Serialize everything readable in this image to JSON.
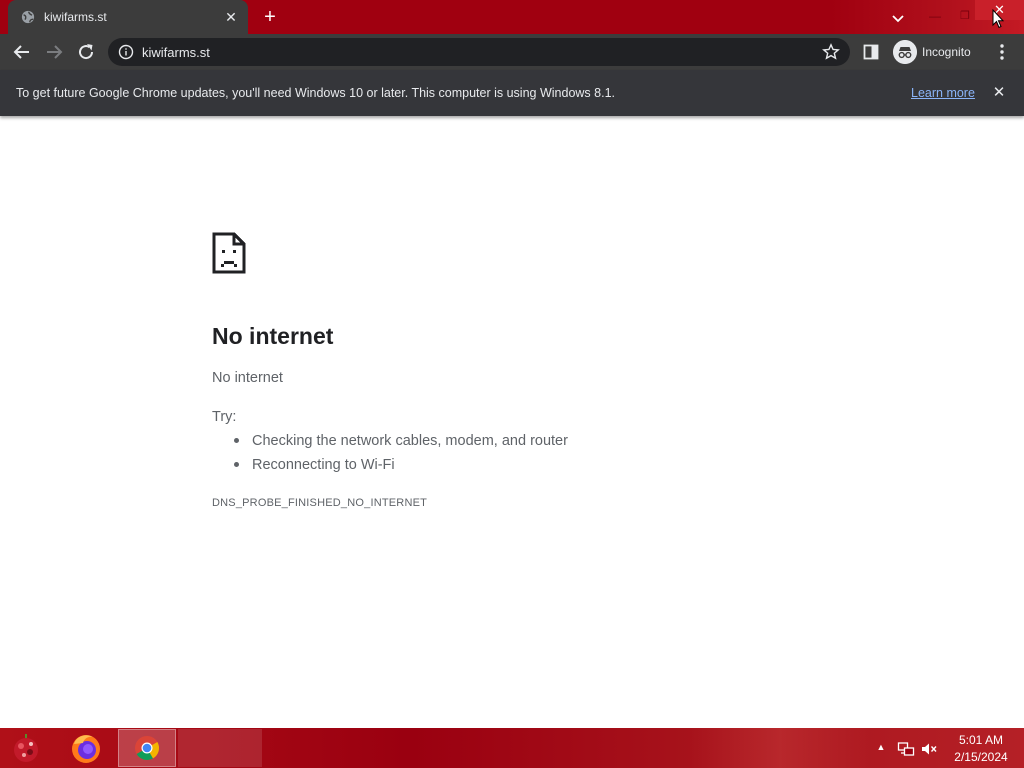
{
  "browser": {
    "tab": {
      "title": "kiwifarms.st",
      "close_glyph": "✕"
    },
    "new_tab_glyph": "+",
    "window_controls": {
      "minimize": "—",
      "maximize": "❐",
      "close": "✕"
    },
    "toolbar": {
      "url": "kiwifarms.st",
      "profile_label": "Incognito"
    },
    "infobar": {
      "message": "To get future Google Chrome updates, you'll need Windows 10 or later. This computer is using Windows 8.1.",
      "link": "Learn more",
      "close_glyph": "✕"
    },
    "icons": [
      "globe-icon",
      "close-icon",
      "plus-icon",
      "chevron-down-icon",
      "back-arrow-icon",
      "forward-arrow-icon",
      "reload-icon",
      "info-icon",
      "star-icon",
      "side-panel-icon",
      "incognito-icon",
      "kebab-menu-icon",
      "sad-document-icon"
    ]
  },
  "page": {
    "title": "No internet",
    "subtitle": "No internet",
    "try_label": "Try:",
    "suggestions": [
      "Checking the network cables, modem, and router",
      "Reconnecting to Wi-Fi"
    ],
    "error_code": "DNS_PROBE_FINISHED_NO_INTERNET"
  },
  "taskbar": {
    "apps": [
      "Firefox",
      "Google Chrome"
    ],
    "tray_arrow": "▲",
    "time": "5:01 AM",
    "date": "2/15/2024"
  },
  "colors": {
    "window_frame": "#a00010",
    "toolbar": "#3c3c3c",
    "infobar": "#35363a",
    "link": "#8ab4f8",
    "title_text": "#202124",
    "body_text": "#5f6368"
  }
}
